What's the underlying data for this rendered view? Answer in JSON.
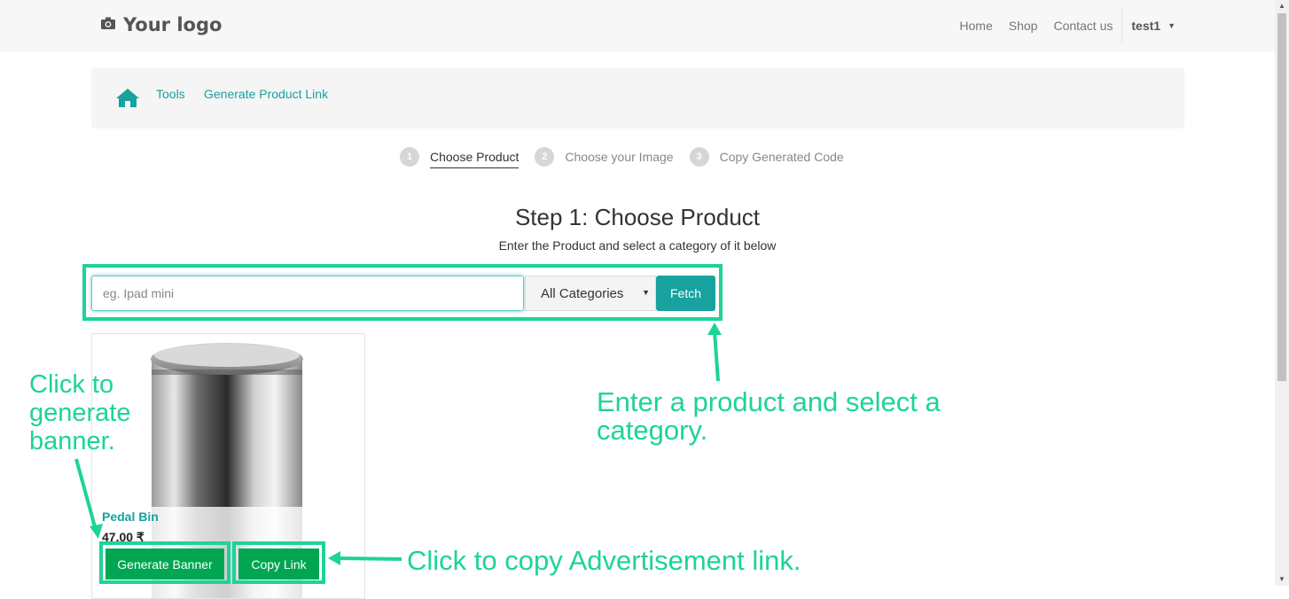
{
  "navbar": {
    "logo_text": "Your logo",
    "links": [
      "Home",
      "Shop",
      "Contact us"
    ],
    "user": "test1"
  },
  "breadcrumb": {
    "items": [
      "Tools",
      "Generate Product Link"
    ]
  },
  "steps": [
    {
      "num": "1",
      "label": "Choose Product",
      "active": true
    },
    {
      "num": "2",
      "label": "Choose your Image",
      "active": false
    },
    {
      "num": "3",
      "label": "Copy Generated Code",
      "active": false
    }
  ],
  "main": {
    "title": "Step 1: Choose Product",
    "subtitle": "Enter the Product and select a category of it below"
  },
  "search": {
    "placeholder": "eg. Ipad mini",
    "category_selected": "All Categories",
    "fetch_label": "Fetch"
  },
  "product": {
    "name": "Pedal Bin",
    "price": "47.00 ₹",
    "generate_label": "Generate Banner",
    "copy_label": "Copy Link"
  },
  "annotations": {
    "banner": "Click to generate banner.",
    "search": "Enter a product and select a category.",
    "copy": "Click to copy Advertisement link."
  },
  "colors": {
    "accent": "#17a2a0",
    "annotation": "#1dd39a",
    "button_green": "#00a651"
  }
}
